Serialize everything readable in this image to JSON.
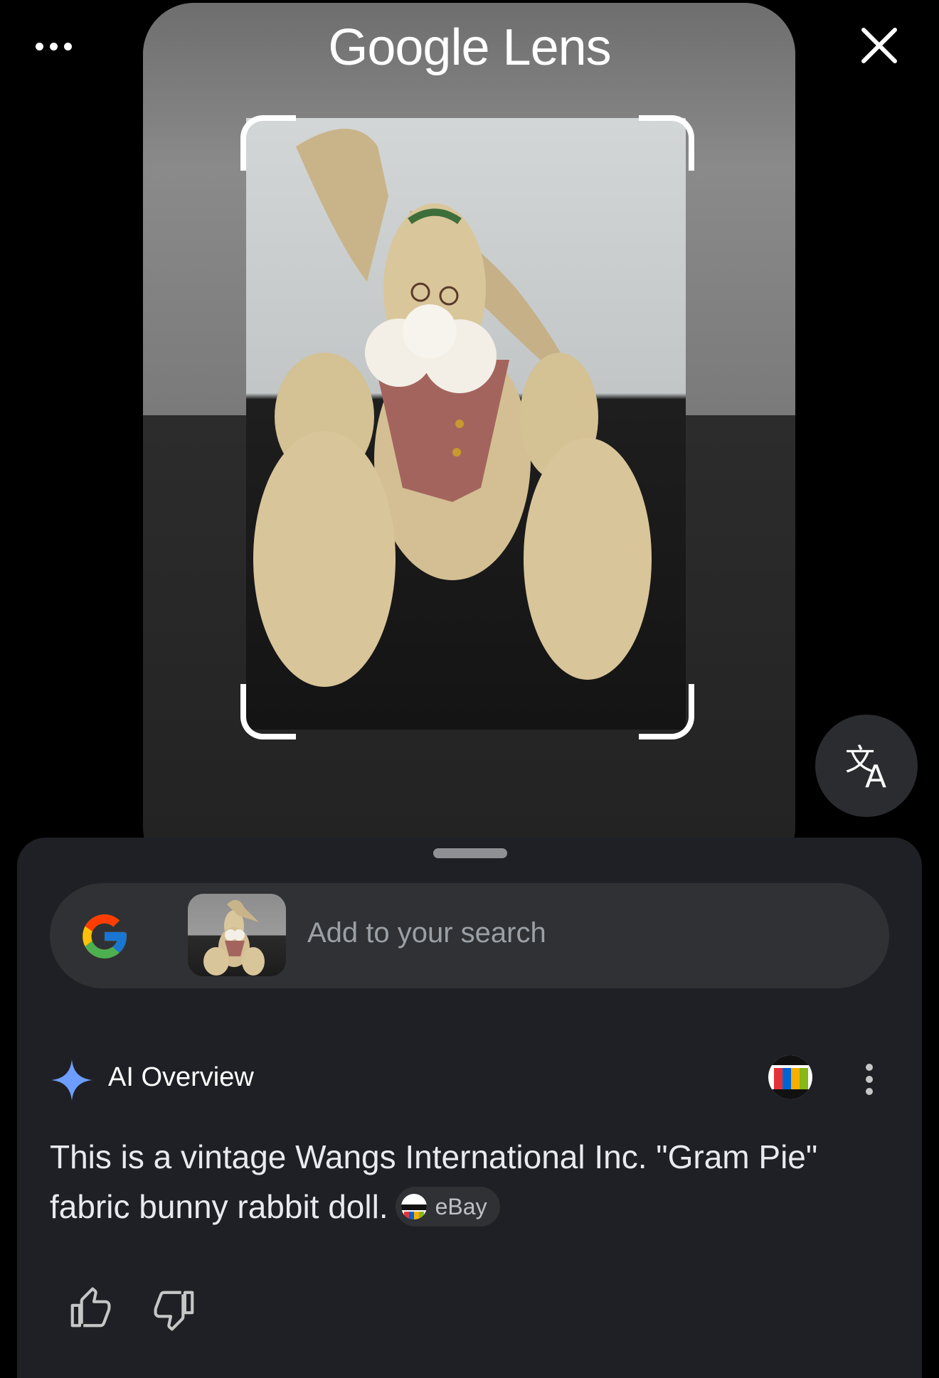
{
  "header": {
    "title": "Google Lens"
  },
  "icons": {
    "more": "more-horiz-icon",
    "close": "close-icon",
    "translate": "translate-icon",
    "google": "google-g-icon",
    "spark": "ai-spark-icon",
    "source": "ebay-source-icon",
    "kebab": "more-vert-icon",
    "thumb_up": "thumb-up-icon",
    "thumb_down": "thumb-down-icon"
  },
  "search": {
    "placeholder": "Add to your search"
  },
  "ai_overview": {
    "title": "AI Overview",
    "text": "This is a vintage Wangs International Inc. \"Gram Pie\" fabric bunny rabbit doll.",
    "source_chip": "eBay"
  },
  "colors": {
    "sheet_bg": "#1f2025",
    "pill_bg": "#303134",
    "accent_spark": "#6d9eff",
    "google_blue": "#4285F4",
    "google_red": "#EA4335",
    "google_yellow": "#FBBC05",
    "google_green": "#34A853"
  }
}
